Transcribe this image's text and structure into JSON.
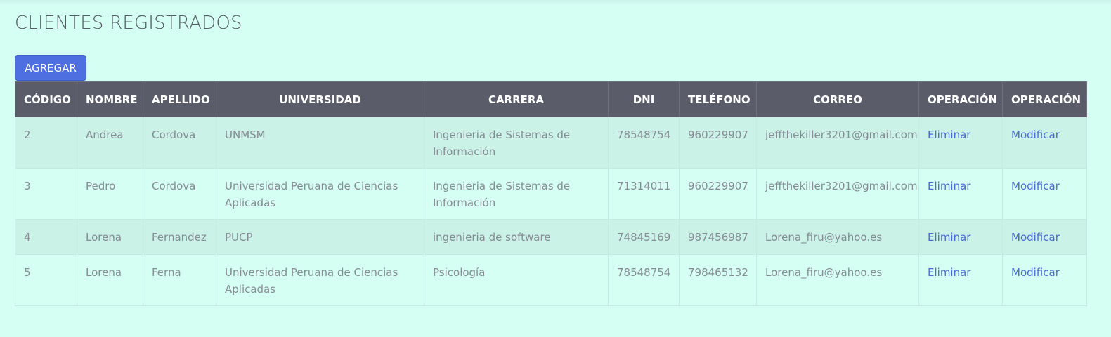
{
  "page": {
    "title": "CLIENTES REGISTRADOS",
    "add_button_label": "AGREGAR"
  },
  "table": {
    "headers": [
      "CÓDIGO",
      "NOMBRE",
      "APELLIDO",
      "UNIVERSIDAD",
      "CARRERA",
      "DNI",
      "TELÉFONO",
      "CORREO",
      "OPERACIÓN",
      "OPERACIÓN"
    ],
    "rows": [
      {
        "codigo": "2",
        "nombre": "Andrea",
        "apellido": "Cordova",
        "universidad": "UNMSM",
        "carrera": "Ingenieria de Sistemas de Información",
        "dni": "78548754",
        "telefono": "960229907",
        "correo": "jeffthekiller3201@gmail.com",
        "eliminar": "Eliminar",
        "modificar": "Modificar"
      },
      {
        "codigo": "3",
        "nombre": "Pedro",
        "apellido": "Cordova",
        "universidad": "Universidad Peruana de Ciencias Aplicadas",
        "carrera": "Ingenieria de Sistemas de Información",
        "dni": "71314011",
        "telefono": "960229907",
        "correo": "jeffthekiller3201@gmail.com",
        "eliminar": "Eliminar",
        "modificar": "Modificar"
      },
      {
        "codigo": "4",
        "nombre": "Lorena",
        "apellido": "Fernandez",
        "universidad": "PUCP",
        "carrera": "ingenieria de software",
        "dni": "74845169",
        "telefono": "987456987",
        "correo": "Lorena_firu@yahoo.es",
        "eliminar": "Eliminar",
        "modificar": "Modificar"
      },
      {
        "codigo": "5",
        "nombre": "Lorena",
        "apellido": "Ferna",
        "universidad": "Universidad Peruana de Ciencias Aplicadas",
        "carrera": "Psicología",
        "dni": "78548754",
        "telefono": "798465132",
        "correo": "Lorena_firu@yahoo.es",
        "eliminar": "Eliminar",
        "modificar": "Modificar"
      }
    ]
  },
  "colors": {
    "background": "#d6fff4",
    "header_bg": "#5a5c6a",
    "stripe_bg": "#caf2e7",
    "button_bg": "#4e6fe0",
    "link": "#4a6bd6"
  }
}
